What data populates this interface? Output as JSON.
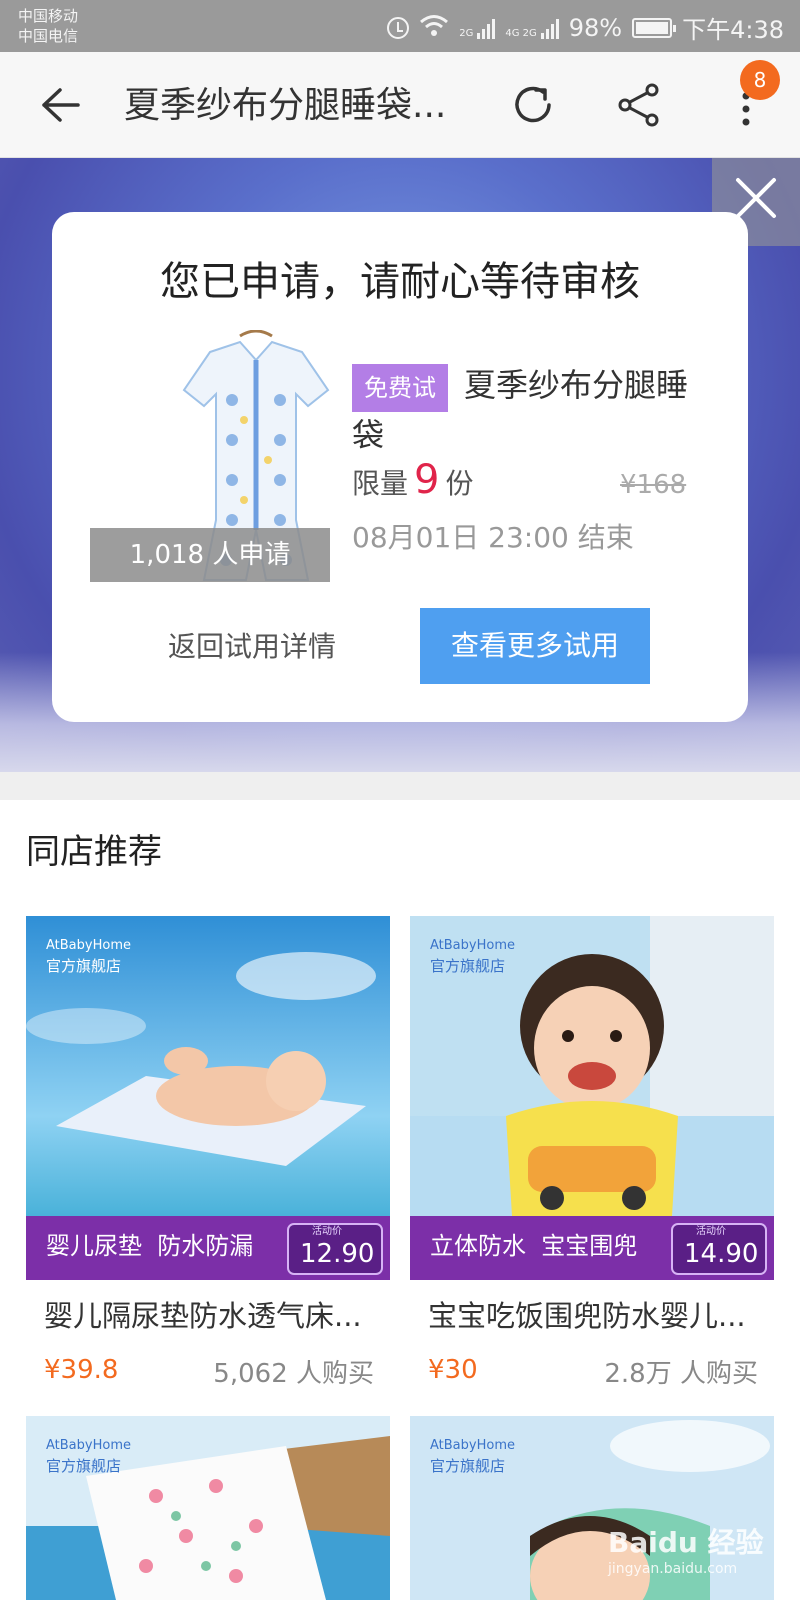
{
  "status_bar": {
    "carrier1": "中国移动",
    "carrier2": "中国电信",
    "network_tag": "2G",
    "network_tag2": "4G 2G",
    "battery": "98%",
    "time": "下午4:38"
  },
  "title_bar": {
    "title": "夏季纱布分腿睡袋...",
    "badge_count": "8",
    "icons": [
      "back-arrow-icon",
      "refresh-icon",
      "share-icon",
      "more-vertical-icon"
    ]
  },
  "dialog": {
    "title": "您已申请，请耐心等待审核",
    "applicants": "1,018 人申请",
    "trial_tag": "免费试",
    "product_name": "夏季纱布分腿睡袋",
    "quota_prefix": "限量",
    "quota_value": "9",
    "quota_suffix": "份",
    "original_price": "¥168",
    "end_time": "08月01日 23:00 结束",
    "back_button": "返回试用详情",
    "more_button": "查看更多试用"
  },
  "recommend": {
    "title": "同店推荐",
    "items": [
      {
        "brand": "AtBabyHome",
        "store": "官方旗舰店",
        "banner_text": "婴儿尿垫  防水防漏",
        "promo_label": "活动价",
        "promo_price": "12.90",
        "name": "婴儿隔尿垫防水透气床...",
        "price": "¥39.8",
        "sold": "5,062 人购买"
      },
      {
        "brand": "AtBabyHome",
        "store": "官方旗舰店",
        "banner_text": "立体防水  宝宝围兜",
        "promo_label": "活动价",
        "promo_price": "14.90",
        "name": "宝宝吃饭围兜防水婴儿...",
        "price": "¥30",
        "sold": "2.8万 人购买"
      },
      {
        "brand": "AtBabyHome",
        "store": "官方旗舰店"
      },
      {
        "brand": "AtBabyHome",
        "store": "官方旗舰店"
      }
    ]
  },
  "watermark": {
    "logo": "Baidu 经验",
    "url": "jingyan.baidu.com"
  },
  "colors": {
    "accent_orange": "#f36a1f",
    "primary_blue": "#4f9ff0",
    "trial_purple": "#b37ee6",
    "quota_red": "#e0244a"
  }
}
